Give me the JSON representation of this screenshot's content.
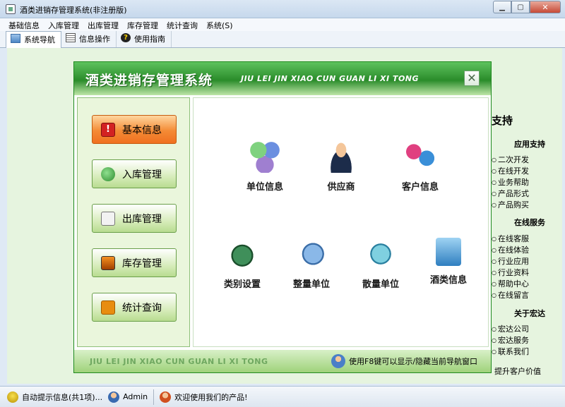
{
  "window": {
    "title": "酒类进销存管理系统(非注册版)",
    "minimize_label": "▁",
    "maximize_label": "▢",
    "close_label": "✕"
  },
  "menu": [
    "基础信息",
    "入库管理",
    "出库管理",
    "库存管理",
    "统计查询",
    "系统(S)"
  ],
  "tabs": [
    {
      "label": "系统导航",
      "icon": "navigation-icon",
      "active": true
    },
    {
      "label": "信息操作",
      "icon": "document-icon",
      "active": false
    },
    {
      "label": "使用指南",
      "icon": "help-icon",
      "active": false
    }
  ],
  "nav_panel": {
    "title": "酒类进销存管理系统",
    "pinyin": "JIU LEI JIN XIAO CUN GUAN LI XI TONG",
    "close_label": "✕",
    "left_buttons": [
      {
        "label": "基本信息",
        "icon": "warning-icon",
        "active": true
      },
      {
        "label": "入库管理",
        "icon": "inbound-icon",
        "active": false
      },
      {
        "label": "出库管理",
        "icon": "outbound-icon",
        "active": false
      },
      {
        "label": "库存管理",
        "icon": "monitor-icon",
        "active": false
      },
      {
        "label": "统计查询",
        "icon": "rss-icon",
        "active": false
      }
    ],
    "features": [
      {
        "label": "单位信息",
        "icon": "users-group-icon"
      },
      {
        "label": "供应商",
        "icon": "businessman-icon"
      },
      {
        "label": "客户信息",
        "icon": "customer-globe-icon"
      },
      {
        "label": "类别设置",
        "icon": "category-icon"
      },
      {
        "label": "整量单位",
        "icon": "whole-unit-icon"
      },
      {
        "label": "散量单位",
        "icon": "bulk-unit-icon"
      },
      {
        "label": "酒类信息",
        "icon": "wine-folder-icon"
      }
    ],
    "footer_pinyin": "JIU LEI JIN XIAO CUN GUAN LI XI TONG",
    "footer_hint": "使用F8键可以显示/隐藏当前导航窗口"
  },
  "right_sidebar": {
    "title": "支持",
    "sections": [
      {
        "heading": "应用支持",
        "items": [
          "二次开发",
          "在线开发",
          "业务帮助",
          "产品形式",
          "产品购买"
        ]
      },
      {
        "heading": "在线服务",
        "items": [
          "在线客服",
          "在线体验",
          "行业应用",
          "行业资料",
          "帮助中心",
          "在线留言"
        ]
      },
      {
        "heading": "关于宏达",
        "items": [
          "宏达公司",
          "宏达服务",
          "联系我们"
        ]
      }
    ],
    "footer": "提升客户价值"
  },
  "statusbar": {
    "tips": "自动提示信息(共1项)...",
    "user": "Admin",
    "message": "欢迎使用我们的产品!"
  }
}
